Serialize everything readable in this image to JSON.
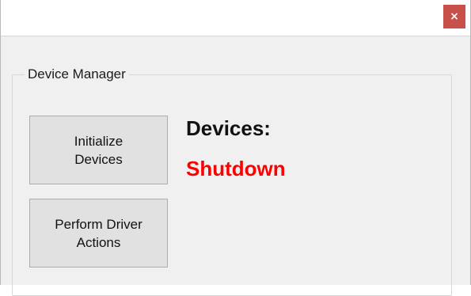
{
  "window": {
    "close_glyph": "×"
  },
  "group": {
    "label": "Device Manager"
  },
  "buttons": {
    "initialize": "Initialize\nDevices",
    "driver_actions": "Perform Driver\nActions"
  },
  "status": {
    "devices_label": "Devices:",
    "state": "Shutdown",
    "state_color": "#ff0000"
  },
  "colors": {
    "close_button": "#c7504a"
  }
}
